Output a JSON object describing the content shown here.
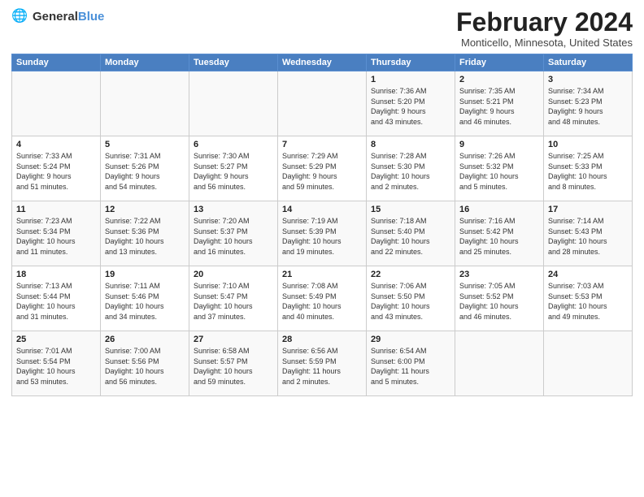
{
  "header": {
    "logo_general": "General",
    "logo_blue": "Blue",
    "month": "February 2024",
    "location": "Monticello, Minnesota, United States"
  },
  "days_of_week": [
    "Sunday",
    "Monday",
    "Tuesday",
    "Wednesday",
    "Thursday",
    "Friday",
    "Saturday"
  ],
  "weeks": [
    [
      {
        "day": "",
        "content": ""
      },
      {
        "day": "",
        "content": ""
      },
      {
        "day": "",
        "content": ""
      },
      {
        "day": "",
        "content": ""
      },
      {
        "day": "1",
        "content": "Sunrise: 7:36 AM\nSunset: 5:20 PM\nDaylight: 9 hours\nand 43 minutes."
      },
      {
        "day": "2",
        "content": "Sunrise: 7:35 AM\nSunset: 5:21 PM\nDaylight: 9 hours\nand 46 minutes."
      },
      {
        "day": "3",
        "content": "Sunrise: 7:34 AM\nSunset: 5:23 PM\nDaylight: 9 hours\nand 48 minutes."
      }
    ],
    [
      {
        "day": "4",
        "content": "Sunrise: 7:33 AM\nSunset: 5:24 PM\nDaylight: 9 hours\nand 51 minutes."
      },
      {
        "day": "5",
        "content": "Sunrise: 7:31 AM\nSunset: 5:26 PM\nDaylight: 9 hours\nand 54 minutes."
      },
      {
        "day": "6",
        "content": "Sunrise: 7:30 AM\nSunset: 5:27 PM\nDaylight: 9 hours\nand 56 minutes."
      },
      {
        "day": "7",
        "content": "Sunrise: 7:29 AM\nSunset: 5:29 PM\nDaylight: 9 hours\nand 59 minutes."
      },
      {
        "day": "8",
        "content": "Sunrise: 7:28 AM\nSunset: 5:30 PM\nDaylight: 10 hours\nand 2 minutes."
      },
      {
        "day": "9",
        "content": "Sunrise: 7:26 AM\nSunset: 5:32 PM\nDaylight: 10 hours\nand 5 minutes."
      },
      {
        "day": "10",
        "content": "Sunrise: 7:25 AM\nSunset: 5:33 PM\nDaylight: 10 hours\nand 8 minutes."
      }
    ],
    [
      {
        "day": "11",
        "content": "Sunrise: 7:23 AM\nSunset: 5:34 PM\nDaylight: 10 hours\nand 11 minutes."
      },
      {
        "day": "12",
        "content": "Sunrise: 7:22 AM\nSunset: 5:36 PM\nDaylight: 10 hours\nand 13 minutes."
      },
      {
        "day": "13",
        "content": "Sunrise: 7:20 AM\nSunset: 5:37 PM\nDaylight: 10 hours\nand 16 minutes."
      },
      {
        "day": "14",
        "content": "Sunrise: 7:19 AM\nSunset: 5:39 PM\nDaylight: 10 hours\nand 19 minutes."
      },
      {
        "day": "15",
        "content": "Sunrise: 7:18 AM\nSunset: 5:40 PM\nDaylight: 10 hours\nand 22 minutes."
      },
      {
        "day": "16",
        "content": "Sunrise: 7:16 AM\nSunset: 5:42 PM\nDaylight: 10 hours\nand 25 minutes."
      },
      {
        "day": "17",
        "content": "Sunrise: 7:14 AM\nSunset: 5:43 PM\nDaylight: 10 hours\nand 28 minutes."
      }
    ],
    [
      {
        "day": "18",
        "content": "Sunrise: 7:13 AM\nSunset: 5:44 PM\nDaylight: 10 hours\nand 31 minutes."
      },
      {
        "day": "19",
        "content": "Sunrise: 7:11 AM\nSunset: 5:46 PM\nDaylight: 10 hours\nand 34 minutes."
      },
      {
        "day": "20",
        "content": "Sunrise: 7:10 AM\nSunset: 5:47 PM\nDaylight: 10 hours\nand 37 minutes."
      },
      {
        "day": "21",
        "content": "Sunrise: 7:08 AM\nSunset: 5:49 PM\nDaylight: 10 hours\nand 40 minutes."
      },
      {
        "day": "22",
        "content": "Sunrise: 7:06 AM\nSunset: 5:50 PM\nDaylight: 10 hours\nand 43 minutes."
      },
      {
        "day": "23",
        "content": "Sunrise: 7:05 AM\nSunset: 5:52 PM\nDaylight: 10 hours\nand 46 minutes."
      },
      {
        "day": "24",
        "content": "Sunrise: 7:03 AM\nSunset: 5:53 PM\nDaylight: 10 hours\nand 49 minutes."
      }
    ],
    [
      {
        "day": "25",
        "content": "Sunrise: 7:01 AM\nSunset: 5:54 PM\nDaylight: 10 hours\nand 53 minutes."
      },
      {
        "day": "26",
        "content": "Sunrise: 7:00 AM\nSunset: 5:56 PM\nDaylight: 10 hours\nand 56 minutes."
      },
      {
        "day": "27",
        "content": "Sunrise: 6:58 AM\nSunset: 5:57 PM\nDaylight: 10 hours\nand 59 minutes."
      },
      {
        "day": "28",
        "content": "Sunrise: 6:56 AM\nSunset: 5:59 PM\nDaylight: 11 hours\nand 2 minutes."
      },
      {
        "day": "29",
        "content": "Sunrise: 6:54 AM\nSunset: 6:00 PM\nDaylight: 11 hours\nand 5 minutes."
      },
      {
        "day": "",
        "content": ""
      },
      {
        "day": "",
        "content": ""
      }
    ]
  ]
}
